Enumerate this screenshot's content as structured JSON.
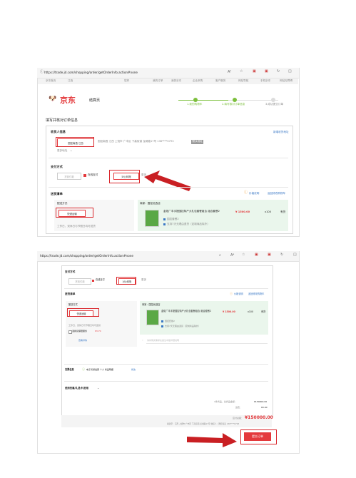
{
  "shot1": {
    "url": "https://trade.jd.com/shopping/order/getOrderInfo.action#none",
    "topbar": {
      "left": [
        "京东首页",
        "江西"
      ],
      "right": [
        "您好",
        "我的订单",
        "我的京东",
        "企业采购",
        "客户服务",
        "网站导航",
        "手机京东",
        "网站无障碍"
      ]
    },
    "logo_text": "京东",
    "checkout_title": "结算页",
    "steps": [
      "1.我的购物车",
      "2.填写核对订单信息",
      "3.成功提交订单"
    ],
    "page_heading": "填写并核对订单信息",
    "receiver": {
      "title": "收货人信息",
      "new_address": "新增收货地址",
      "selected_name": "国控南昌 江西",
      "detail": "国控南昌 江西 上饶市 广丰区 下高街道 龙城路17号 136****0793",
      "default_tag": "默认地址",
      "more": "更多地址"
    },
    "payment": {
      "title": "支付方式",
      "options": [
        "货到付款",
        "在线支付",
        "对公转账"
      ],
      "more": "更多"
    },
    "list": {
      "title": "送货清单",
      "price_note": "价格说明",
      "back_to_cart": "返回修改购物车",
      "delivery_title": "配送方式",
      "delivery_option": "快递运输",
      "delivery_note": "工作日、双休日与节假日均可送货",
      "shop_label": "商家：国控优选店",
      "product_name": "金佑广丰手提国控特产大礼包套餐组合 组合套餐2",
      "product_tag": "国控套餐2",
      "product_service": "支持7天无理由退货（定制商品除外）",
      "price": "¥ 1500.00",
      "qty": "x100",
      "stock": "有货"
    }
  },
  "shot2": {
    "url": "https://trade.jd.com/shopping/order/getOrderInfo.action#none",
    "payment": {
      "title": "支付方式",
      "options": [
        "货到付款",
        "在线支付",
        "对公转账"
      ],
      "more": "更多"
    },
    "list": {
      "title": "送货清单",
      "price_note": "价格说明",
      "back_to_cart": "返回修改购物车",
      "delivery_title": "配送方式",
      "delivery_option": "快递运输",
      "delivery_note": "工作日、双休日与节假日均可送货",
      "insurance": "退换货保障服务",
      "insurance_price": "¥3.70",
      "insurance_detail": "查看详情",
      "shop_label": "商家：国控优选店",
      "product_name": "金佑广丰手提国控特产大礼包套餐组合 组合套餐2",
      "product_tag": "国控套餐2",
      "product_service": "支持7天无理由退货（定制商品除外）",
      "price": "¥ 1500.00",
      "qty": "x100",
      "stock": "有货",
      "remark_placeholder": "请将购买需求在备注中做详细说明"
    },
    "invoice": {
      "title": "发票信息",
      "text": "电子普通发票 个人 商品明细",
      "modify": "修改"
    },
    "coupon": "使用优惠/礼品卡/抵用",
    "totals": {
      "amount_label": "1件商品，总商品金额：",
      "amount": "¥150000.00",
      "freight_label": "运费：",
      "freight": "¥0.00",
      "payable_label": "应付总额：",
      "payable": "¥150000.00",
      "ship_to": "寄送至：江西 上饶市 广丰区 下高街道 龙城路17号 收货人：国控南昌 136****0793"
    },
    "submit": "提交订单"
  },
  "colors": {
    "jd_red": "#e4393c",
    "highlight": "#d9262b",
    "arrow": "#c91f23",
    "step_green": "#7cbf3c"
  }
}
